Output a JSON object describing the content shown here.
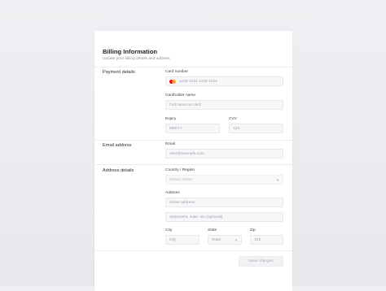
{
  "header": {
    "title": "Billing Information",
    "subtitle": "Update your billing details and address"
  },
  "payment": {
    "section_label": "Payment details",
    "card_number_label": "Card number",
    "card_number_placeholder": "1234 1234 1234 1234",
    "card_icon": "mastercard-icon",
    "cardholder_label": "Cardholder name",
    "cardholder_placeholder": "Full name on card",
    "expiry_label": "Expiry",
    "expiry_placeholder": "MM/YY",
    "cvv_label": "CVV",
    "cvv_placeholder": "123"
  },
  "email": {
    "section_label": "Email address",
    "field_label": "Email",
    "placeholder": "user@example.com"
  },
  "address": {
    "section_label": "Address details",
    "country_label": "Country / Region",
    "country_value": "United States",
    "address_label": "Address",
    "street_placeholder": "Street address",
    "apartment_placeholder": "Apartment, suite, etc (optional)",
    "city_label": "City",
    "city_placeholder": "City",
    "state_label": "State",
    "state_value": "State",
    "zip_label": "Zip",
    "zip_placeholder": "123"
  },
  "actions": {
    "save_label": "Save changes"
  },
  "colors": {
    "background": "#eceef1",
    "card": "#ffffff",
    "input_bg": "#f7f7f9",
    "mastercard_red": "#eb001b",
    "mastercard_orange": "#f79e1b"
  }
}
